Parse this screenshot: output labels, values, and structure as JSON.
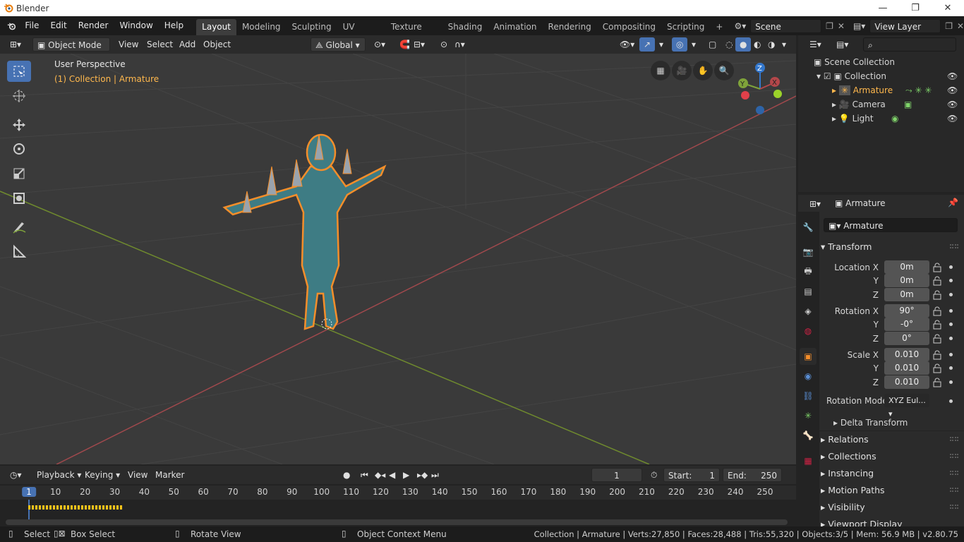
{
  "window": {
    "title": "Blender",
    "minimize": "—",
    "maximize": "❐",
    "close": "✕"
  },
  "menus": [
    "File",
    "Edit",
    "Render",
    "Window",
    "Help"
  ],
  "workspaces": [
    "Layout",
    "Modeling",
    "Sculpting",
    "UV Editing",
    "Texture Paint",
    "Shading",
    "Animation",
    "Rendering",
    "Compositing",
    "Scripting"
  ],
  "add_tab": "+",
  "scene": {
    "name": "Scene"
  },
  "view_layer": {
    "name": "View Layer"
  },
  "viewport_header": {
    "mode": "Object Mode",
    "menus": [
      "View",
      "Select",
      "Add",
      "Object"
    ],
    "orientation": "Global"
  },
  "viewport": {
    "perspective": "User Perspective",
    "context": "(1) Collection | Armature"
  },
  "gizmo": {
    "z": "Z",
    "y": "Y",
    "x": "X"
  },
  "outliner": {
    "root": "Scene Collection",
    "collection": "Collection",
    "items": [
      {
        "name": "Armature",
        "selected": true
      },
      {
        "name": "Camera",
        "selected": false
      },
      {
        "name": "Light",
        "selected": false
      }
    ]
  },
  "properties": {
    "object_name": "Armature",
    "data_name": "Armature",
    "transform_title": "Transform",
    "location": {
      "label": "Location X",
      "x": "0m",
      "y": "0m",
      "z": "0m"
    },
    "rotation": {
      "label": "Rotation X",
      "x": "90°",
      "y": "-0°",
      "z": "0°"
    },
    "scale": {
      "label": "Scale X",
      "x": "0.010",
      "y": "0.010",
      "z": "0.010"
    },
    "axis_y": "Y",
    "axis_z": "Z",
    "rotation_mode": {
      "label": "Rotation Mode",
      "value": "XYZ Eul..."
    },
    "delta": "Delta Transform",
    "panels": [
      "Relations",
      "Collections",
      "Instancing",
      "Motion Paths",
      "Visibility",
      "Viewport Display"
    ]
  },
  "timeline": {
    "menus": [
      "Playback",
      "Keying",
      "View",
      "Marker"
    ],
    "current_frame": "1",
    "start_label": "Start:",
    "start": "1",
    "end_label": "End:",
    "end": "250",
    "ruler": [
      "1",
      "10",
      "20",
      "30",
      "40",
      "50",
      "60",
      "70",
      "80",
      "90",
      "100",
      "110",
      "120",
      "130",
      "140",
      "150",
      "160",
      "170",
      "180",
      "190",
      "200",
      "210",
      "220",
      "230",
      "240",
      "250"
    ]
  },
  "statusbar": {
    "select": "Select",
    "box_select": "Box Select",
    "rotate": "Rotate View",
    "context_menu": "Object Context Menu",
    "stats": "Collection | Armature | Verts:27,850 | Faces:28,488 | Tris:55,320 | Objects:3/5 | Mem: 56.9 MB | v2.80.75"
  },
  "colors": {
    "accent": "#4772b3",
    "selection": "#f58e2a",
    "x_axis": "#b3474a",
    "y_axis": "#7fa33a",
    "z_axis": "#3377cc"
  }
}
